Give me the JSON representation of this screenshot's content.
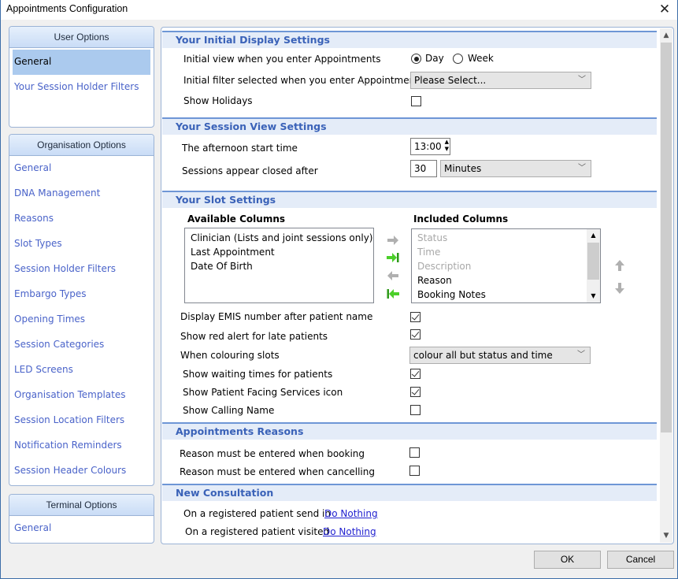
{
  "window": {
    "title": "Appointments Configuration",
    "close_icon": "close-icon"
  },
  "user_options": {
    "header": "User Options",
    "items": [
      {
        "label": "General",
        "selected": true
      },
      {
        "label": "Your Session Holder Filters"
      }
    ]
  },
  "organisation_options": {
    "header": "Organisation Options",
    "items": [
      {
        "label": "General"
      },
      {
        "label": "DNA Management"
      },
      {
        "label": "Reasons"
      },
      {
        "label": "Slot Types"
      },
      {
        "label": "Session Holder Filters"
      },
      {
        "label": "Embargo Types"
      },
      {
        "label": "Opening Times"
      },
      {
        "label": "Session Categories"
      },
      {
        "label": "LED Screens"
      },
      {
        "label": "Organisation Templates"
      },
      {
        "label": "Session Location Filters"
      },
      {
        "label": "Notification Reminders"
      },
      {
        "label": "Session Header Colours"
      }
    ]
  },
  "terminal_options": {
    "header": "Terminal Options",
    "items": [
      {
        "label": "General"
      }
    ]
  },
  "initial_display": {
    "title": "Your Initial Display Settings",
    "view_label": "Initial view when you enter Appointments",
    "view_options": [
      "Day",
      "Week"
    ],
    "view_selected": "Day",
    "filter_label": "Initial filter selected when you enter Appointments",
    "filter_value": "Please Select...",
    "holidays_label": "Show Holidays",
    "holidays_checked": false
  },
  "session_view": {
    "title": "Your Session View Settings",
    "afternoon_label": "The afternoon start time",
    "afternoon_value": "13:00",
    "closed_label": "Sessions appear closed after",
    "closed_value": "30",
    "closed_unit": "Minutes"
  },
  "slot_settings": {
    "title": "Your Slot Settings",
    "available_header": "Available Columns",
    "available": [
      "Clinician (Lists and joint sessions only)",
      "Last Appointment",
      "Date Of Birth"
    ],
    "included_header": "Included Columns",
    "included": [
      {
        "label": "Status",
        "disabled": true
      },
      {
        "label": "Time",
        "disabled": true
      },
      {
        "label": "Description",
        "disabled": true
      },
      {
        "label": "Reason",
        "disabled": false
      },
      {
        "label": "Booking Notes",
        "disabled": false
      }
    ],
    "emis_label": "Display EMIS number after patient name",
    "emis_checked": true,
    "red_alert_label": "Show red alert for late patients",
    "red_alert_checked": true,
    "colouring_label": "When colouring slots",
    "colouring_value": "colour all but status and time",
    "waiting_label": "Show waiting times for patients",
    "waiting_checked": true,
    "pfs_label": "Show Patient Facing Services icon",
    "pfs_checked": true,
    "calling_label": "Show Calling Name",
    "calling_checked": false
  },
  "appointment_reasons": {
    "title": "Appointments Reasons",
    "booking_label": "Reason must be entered when booking",
    "booking_checked": false,
    "cancelling_label": "Reason must be entered when cancelling",
    "cancelling_checked": false
  },
  "new_consultation": {
    "title": "New Consultation",
    "send_in_label": "On a registered patient send in",
    "send_in_action": "Do Nothing",
    "visited_label": "On a registered patient visited",
    "visited_action": "Do Nothing"
  },
  "buttons": {
    "ok": "OK",
    "cancel": "Cancel"
  }
}
